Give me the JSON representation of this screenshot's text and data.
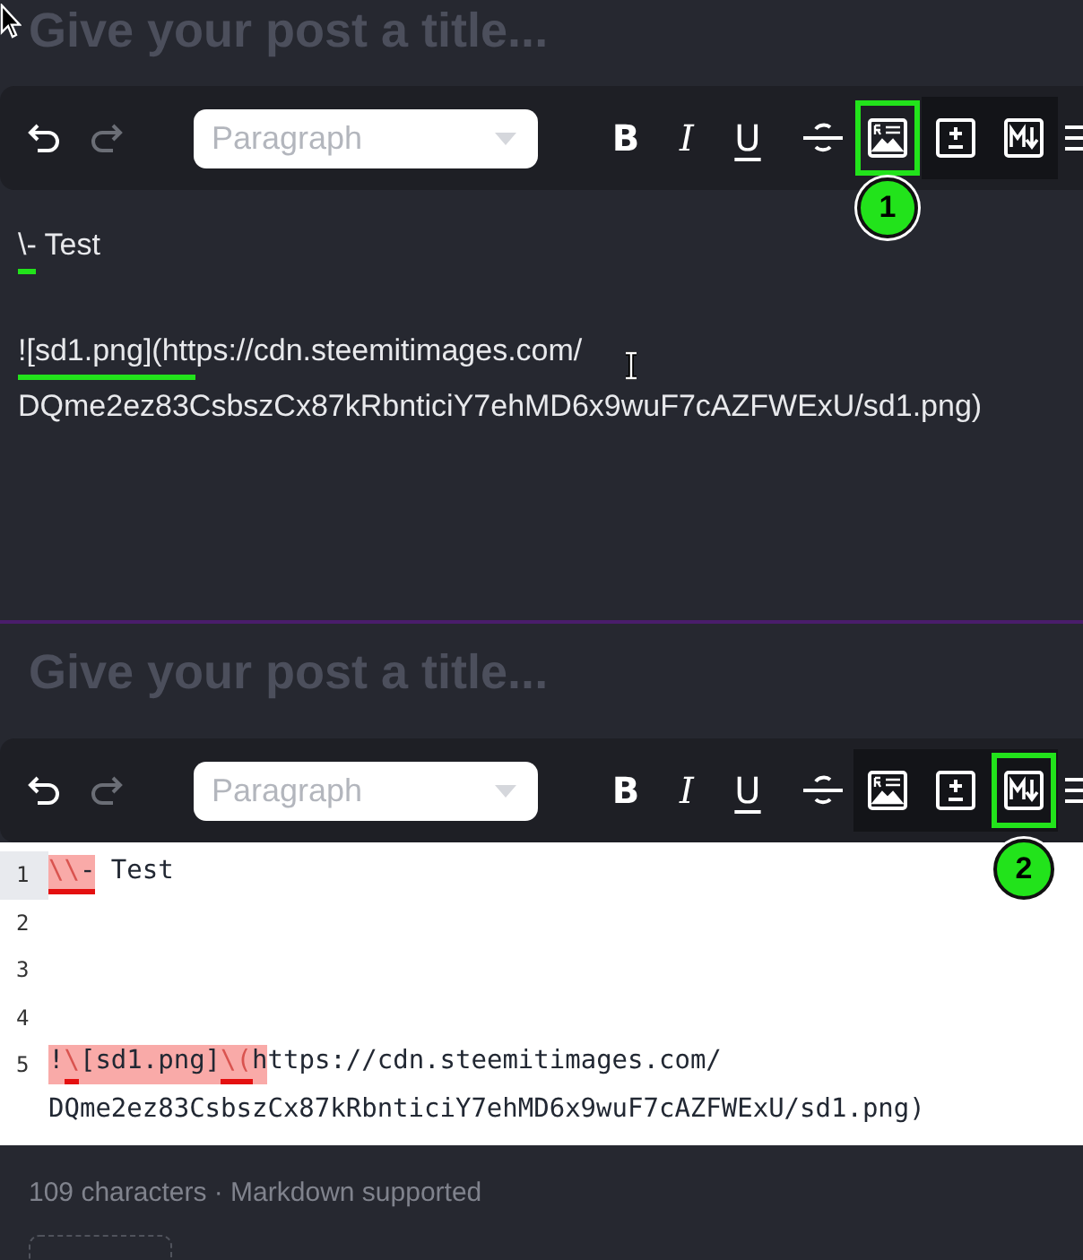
{
  "panels": [
    {
      "kind": "rich",
      "title_placeholder": "Give your post a title...",
      "format_placeholder": "Paragraph",
      "tools": [
        {
          "kind": "undo",
          "disabled": false,
          "grouped": false,
          "highlighted": false
        },
        {
          "kind": "redo",
          "disabled": true,
          "grouped": false,
          "highlighted": false
        },
        {
          "kind": "separator"
        },
        {
          "kind": "format"
        },
        {
          "kind": "separator"
        },
        {
          "kind": "bold",
          "label": "B",
          "disabled": false,
          "grouped": false,
          "highlighted": false
        },
        {
          "kind": "italic",
          "label": "I",
          "disabled": false,
          "grouped": false,
          "highlighted": false
        },
        {
          "kind": "underline",
          "label": "U",
          "disabled": false,
          "grouped": false,
          "highlighted": false
        },
        {
          "kind": "strike",
          "disabled": false,
          "grouped": false,
          "highlighted": false
        },
        {
          "kind": "image-text",
          "disabled": false,
          "grouped": false,
          "highlighted": true,
          "badge": "1"
        },
        {
          "kind": "plus-minus",
          "disabled": false,
          "grouped": true,
          "highlighted": false
        },
        {
          "kind": "markdown",
          "disabled": false,
          "grouped": true,
          "highlighted": false
        },
        {
          "kind": "list",
          "disabled": false,
          "grouped": false,
          "highlighted": false
        }
      ],
      "paragraphs": [
        {
          "lines": [
            [
              {
                "text": "\\-",
                "marked": true
              },
              {
                "text": " Test",
                "marked": false
              }
            ]
          ]
        },
        {
          "lines": [
            [
              {
                "text": "![sd1.png](htt",
                "marked": true
              },
              {
                "text": "ps://cdn.steemitimages.com/",
                "marked": false
              }
            ],
            [
              {
                "text": "DQme2ez83CsbszCx87kRbnticiY7ehMD6x9wuF7cAZFWExU/sd1.png)",
                "marked": false
              }
            ]
          ]
        }
      ]
    },
    {
      "kind": "markdown",
      "title_placeholder": "Give your post a title...",
      "format_placeholder": "Paragraph",
      "tools": [
        {
          "kind": "undo",
          "disabled": false,
          "grouped": false,
          "highlighted": false
        },
        {
          "kind": "redo",
          "disabled": true,
          "grouped": false,
          "highlighted": false
        },
        {
          "kind": "separator"
        },
        {
          "kind": "format"
        },
        {
          "kind": "separator"
        },
        {
          "kind": "bold",
          "label": "B",
          "disabled": false,
          "grouped": false,
          "highlighted": false
        },
        {
          "kind": "italic",
          "label": "I",
          "disabled": false,
          "grouped": false,
          "highlighted": false
        },
        {
          "kind": "underline",
          "label": "U",
          "disabled": false,
          "grouped": false,
          "highlighted": false
        },
        {
          "kind": "strike",
          "disabled": false,
          "grouped": false,
          "highlighted": false
        },
        {
          "kind": "image-text",
          "disabled": false,
          "grouped": true,
          "highlighted": false
        },
        {
          "kind": "plus-minus",
          "disabled": false,
          "grouped": true,
          "highlighted": false
        },
        {
          "kind": "markdown",
          "disabled": false,
          "grouped": true,
          "highlighted": true,
          "badge": "2"
        },
        {
          "kind": "list",
          "disabled": false,
          "grouped": false,
          "highlighted": false
        }
      ],
      "code_lines": [
        {
          "number": "1",
          "active": true,
          "segments": [
            {
              "text": "\\\\",
              "kind": "escape",
              "underline": true
            },
            {
              "text": "-",
              "kind": "mark",
              "underline": true
            },
            {
              "text": " Test",
              "kind": "plain",
              "underline": false
            }
          ]
        },
        {
          "number": "2",
          "active": false
        },
        {
          "number": "3",
          "active": false
        },
        {
          "number": "4",
          "active": false
        },
        {
          "number": "5",
          "active": false,
          "segments": [
            {
              "text": "!",
              "kind": "mark",
              "underline": false
            },
            {
              "text": "\\",
              "kind": "escape",
              "underline": true
            },
            {
              "text": "[sd1.png]",
              "kind": "mark",
              "underline": false
            },
            {
              "text": "\\(",
              "kind": "escape",
              "underline": true
            },
            {
              "text": "h",
              "kind": "mark",
              "underline": false
            },
            {
              "text": "ttps://cdn.steemitimages.com/",
              "kind": "plain",
              "underline": false
            }
          ]
        },
        {
          "active": false,
          "segments": [
            {
              "text": "DQme2ez83CsbszCx87kRbnticiY7ehMD6x9wuF7cAZFWExU/sd1.png)",
              "kind": "plain",
              "underline": false
            }
          ]
        }
      ],
      "footer": "109 characters · Markdown supported"
    }
  ]
}
